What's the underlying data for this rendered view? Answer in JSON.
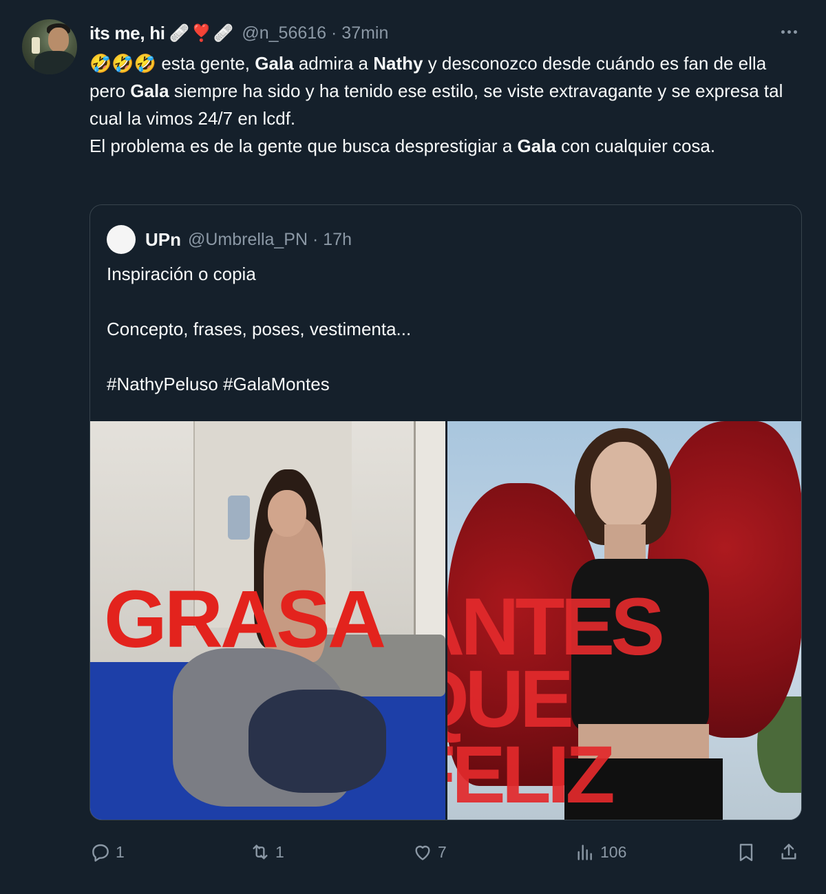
{
  "tweet": {
    "display_name": "its me, hi",
    "name_emojis": "🩹❣️🩹",
    "handle": "@n_56616",
    "time": "37min",
    "body": {
      "line_prefix_emojis": "🤣🤣🤣",
      "t1": " esta gente, ",
      "b1": "Gala",
      "t2": " admira a ",
      "b2": "Nathy",
      "t3": " y desconozco desde cuándo es fan de ella pero ",
      "b3": "Gala",
      "t4": " siempre ha sido y ha tenido ese estilo, se viste extravagante y se expresa tal cual la vimos 24/7 en lcdf.",
      "t5": "El problema es de la gente que busca desprestigiar a ",
      "b4": "Gala",
      "t6": " con cualquier cosa."
    }
  },
  "quoted": {
    "name": "UPn",
    "handle": "@Umbrella_PN",
    "time": "17h",
    "lines": [
      "Inspiración o copia",
      "Concepto, frases, poses, vestimenta...",
      "#NathyPeluso #GalaMontes"
    ],
    "media": {
      "left_text": "GRASA",
      "right_text": [
        "ANTES",
        "QUE",
        "FELIZ"
      ]
    }
  },
  "actions": {
    "replies": "1",
    "retweets": "1",
    "likes": "7",
    "views": "106"
  }
}
